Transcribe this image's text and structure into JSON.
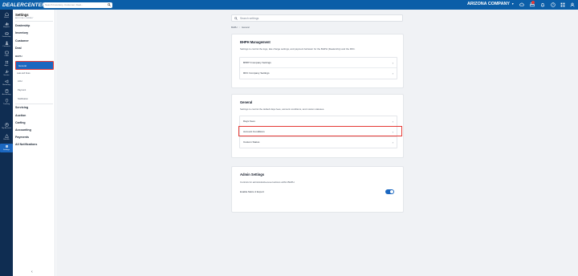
{
  "header": {
    "logo": "DEALERCENTER",
    "search_placeholder": "Search Inventory, Customer, Deal...",
    "company": "ARIZONA COMPANY",
    "icons": [
      "cloud-icon",
      "printer-icon",
      "bell-icon",
      "help-icon",
      "grid-icon",
      "user-icon"
    ]
  },
  "rail": {
    "items": [
      {
        "label": "Home",
        "icon": "home-icon"
      },
      {
        "label": "Reports",
        "icon": "reports-icon"
      },
      {
        "label": "Dealership",
        "icon": "car-icon"
      },
      {
        "label": "Customer",
        "icon": "person-icon"
      },
      {
        "label": "CRM",
        "icon": "crm-icon"
      },
      {
        "label": "Apps",
        "icon": "apps-icon"
      },
      {
        "label": "Service",
        "icon": "wrench-icon"
      },
      {
        "label": "Marketing",
        "icon": "megaphone-icon"
      },
      {
        "label": "Accounting",
        "icon": "calculator-icon"
      },
      {
        "label": "Tracking",
        "icon": "tracking-icon"
      },
      {
        "label": "My Account",
        "icon": "account-icon"
      },
      {
        "label": "Recalls",
        "icon": "recall-icon"
      },
      {
        "label": "Settings",
        "icon": "gear-icon"
      }
    ]
  },
  "nav": {
    "title": "Settings",
    "subtitle": "ARIZONA COMPANY",
    "items": {
      "dealership": "Dealership",
      "inventory": "Inventory",
      "customer": "Customer",
      "deal": "Deal",
      "bhph": "BHPH",
      "general": "General",
      "late_fees": "Late and Fees",
      "ach": "ACH",
      "payment": "Payment",
      "notification": "Notification",
      "servicing": "Servicing",
      "auction": "Auction",
      "carfing": "Carfing",
      "accounting": "Accounting",
      "payments": "Payments",
      "all_notifications": "All Notifications"
    },
    "collapse": "‹"
  },
  "main": {
    "search_placeholder": "Search settings",
    "breadcrumb": {
      "root": "BHPH",
      "sep": ">",
      "current": "General"
    },
    "bhph_card": {
      "title": "BHPH Management",
      "desc": "Settings to control the logo, late charge settings, and payment behavior for the BHPH (Dealership) and the RFC.",
      "rows": [
        "BHPH Company Settings",
        "RFC Company Settings"
      ]
    },
    "general_card": {
      "title": "General",
      "desc": "Settings to control the default days fees, account conditions, and custom statuses.",
      "rows": [
        "Days Fees",
        "Account Conditions",
        "Custom Status"
      ]
    },
    "admin_card": {
      "title": "Admin Settings",
      "desc": "Controls for administrative-level actions within BHPH.",
      "toggle_label": "Enable Metro 2 Export",
      "toggle_on": true
    }
  },
  "colors": {
    "header_bg": "#0b5ea8",
    "rail_bg": "#0f2d52",
    "accent": "#1b67c0",
    "highlight": "#e53935"
  }
}
